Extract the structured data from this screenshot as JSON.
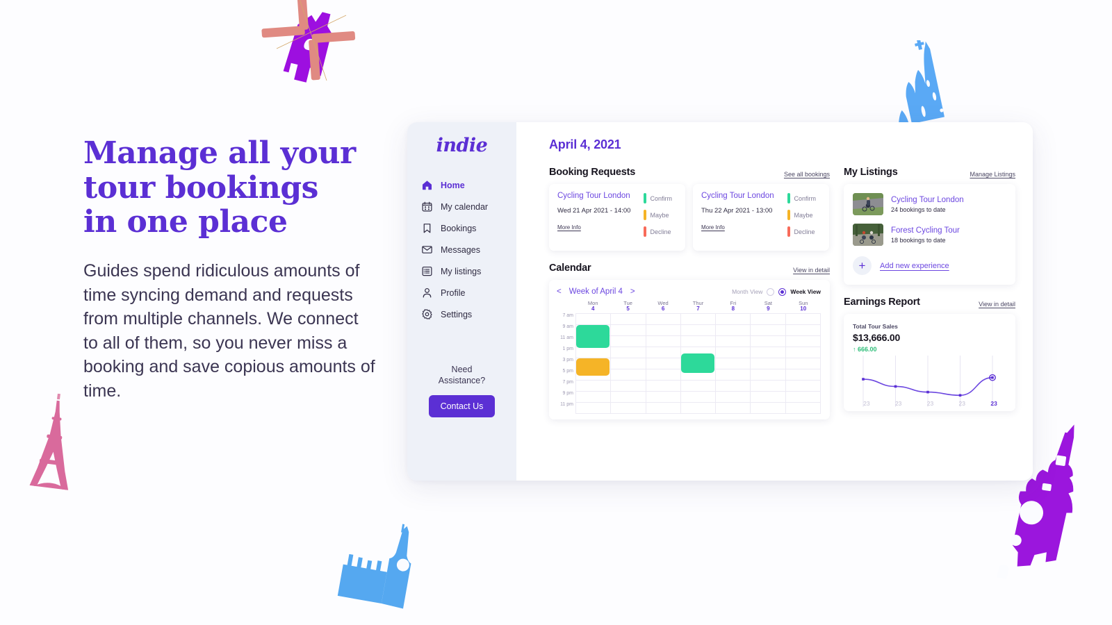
{
  "marketing": {
    "headline_lines": [
      "Manage all your",
      "tour bookings",
      "in one place"
    ],
    "body": "Guides spend ridiculous amounts of time syncing demand and requests from multiple channels. We connect to all of them, so you never miss a booking and save copious amounts of time.",
    "headline_color": "#5b2fd4"
  },
  "app": {
    "sidebar": {
      "logo": "indie",
      "items": [
        {
          "label": "Home",
          "icon": "home-icon",
          "active": true
        },
        {
          "label": "My calendar",
          "icon": "calendar-icon",
          "active": false
        },
        {
          "label": "Bookings",
          "icon": "bookmark-icon",
          "active": false
        },
        {
          "label": "Messages",
          "icon": "envelope-icon",
          "active": false
        },
        {
          "label": "My listings",
          "icon": "list-icon",
          "active": false
        },
        {
          "label": "Profile",
          "icon": "person-icon",
          "active": false
        },
        {
          "label": "Settings",
          "icon": "gear-icon",
          "active": false
        }
      ],
      "assistance_title": "Need Assistance?",
      "contact_label": "Contact Us"
    },
    "date_title": "April 4, 2021",
    "booking_requests": {
      "title": "Booking Requests",
      "link": "See all bookings",
      "actions": [
        {
          "label": "Confirm",
          "color": "#2dd99a"
        },
        {
          "label": "Maybe",
          "color": "#f5b427"
        },
        {
          "label": "Decline",
          "color": "#f86b5a"
        }
      ],
      "cards": [
        {
          "title": "Cycling Tour London",
          "when": "Wed 21 Apr 2021 - 14:00",
          "more": "More Info"
        },
        {
          "title": "Cycling Tour London",
          "when": "Thu 22 Apr 2021 - 13:00",
          "more": "More Info"
        }
      ]
    },
    "calendar": {
      "title": "Calendar",
      "link": "View in detail",
      "prev": "<",
      "next": ">",
      "week_label": "Week of April 4",
      "month_view_label": "Month View",
      "week_view_label": "Week View",
      "selected_view": "Week View",
      "times": [
        "7 am",
        "9 am",
        "11 am",
        "1 pm",
        "3 pm",
        "5 pm",
        "7 pm",
        "9 pm",
        "11 pm"
      ],
      "days": [
        {
          "name": "Mon",
          "num": "4"
        },
        {
          "name": "Tue",
          "num": "5"
        },
        {
          "name": "Wed",
          "num": "6"
        },
        {
          "name": "Thur",
          "num": "7"
        },
        {
          "name": "Fri",
          "num": "8"
        },
        {
          "name": "Sat",
          "num": "9"
        },
        {
          "name": "Sun",
          "num": "10"
        }
      ],
      "events": [
        {
          "day": 0,
          "start_row": 1,
          "span_rows": 2,
          "color": "#2dd99a"
        },
        {
          "day": 0,
          "start_row": 4,
          "span_rows": 1.5,
          "color": "#f5b427"
        },
        {
          "day": 3,
          "start_row": 3.6,
          "span_rows": 1.7,
          "color": "#2dd99a"
        }
      ]
    },
    "listings": {
      "title": "My Listings",
      "link": "Manage Listings",
      "items": [
        {
          "title": "Cycling Tour London",
          "sub": "24 bookings to date",
          "thumb": "cyclist-road-photo"
        },
        {
          "title": "Forest Cycling Tour",
          "sub": "18 bookings to date",
          "thumb": "cyclists-forest-photo"
        }
      ],
      "add_label": "Add new experience"
    },
    "earnings": {
      "title": "Earnings Report",
      "link": "View in detail",
      "metric_label": "Total Tour Sales",
      "metric_value": "$13,666.00",
      "delta": "↑ 666.00",
      "delta_color": "#2dbd78"
    }
  },
  "chart_data": {
    "type": "line",
    "title": "Total Tour Sales",
    "xlabel": "",
    "ylabel": "",
    "categories": [
      "23",
      "23",
      "23",
      "23",
      "23"
    ],
    "values": [
      62,
      44,
      30,
      22,
      66
    ],
    "ylim": [
      0,
      100
    ],
    "grid": false,
    "legend": "none",
    "line_color": "#6b46e0",
    "marker_color": "#5b2fd4",
    "highlight_index": 4,
    "gridline_color": "#e7e4f2",
    "annotations": [
      {
        "text": "$13,666.00",
        "kind": "metric-value"
      },
      {
        "text": "↑ 666.00",
        "kind": "metric-delta"
      }
    ]
  },
  "decorations": [
    {
      "name": "windmill",
      "colors": [
        "#9d0fe0",
        "#e08a82"
      ]
    },
    {
      "name": "cathedral-blue",
      "colors": [
        "#5aa9f5"
      ]
    },
    {
      "name": "eiffel-tower-pink",
      "colors": [
        "#d96a9c"
      ]
    },
    {
      "name": "big-ben-blue",
      "colors": [
        "#55a8f0"
      ]
    },
    {
      "name": "clock-tower-purple",
      "colors": [
        "#9b16dd"
      ]
    }
  ]
}
